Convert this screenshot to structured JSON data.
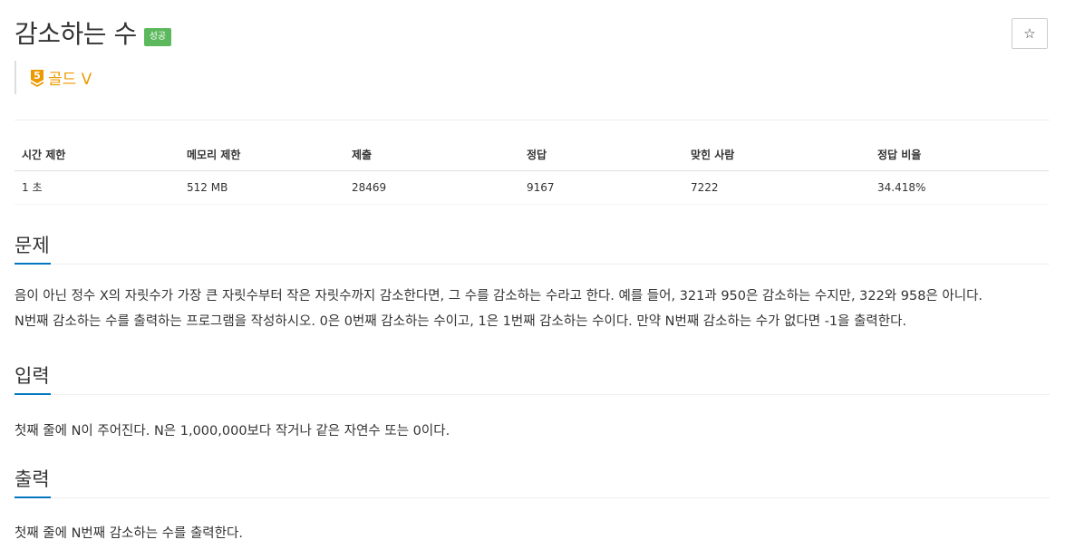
{
  "problem": {
    "title": "감소하는 수",
    "result_badge": "성공",
    "star_icon": "☆",
    "tier": {
      "number": "5",
      "label": "골드 V",
      "color": "#ec9a00"
    }
  },
  "stats": {
    "headers": [
      "시간 제한",
      "메모리 제한",
      "제출",
      "정답",
      "맞힌 사람",
      "정답 비율"
    ],
    "values": [
      "1 초",
      "512 MB",
      "28469",
      "9167",
      "7222",
      "34.418%"
    ]
  },
  "sections": {
    "description": {
      "title": "문제",
      "lines": [
        "음이 아닌 정수 X의 자릿수가 가장 큰 자릿수부터 작은 자릿수까지 감소한다면, 그 수를 감소하는 수라고 한다. 예를 들어, 321과 950은 감소하는 수지만, 322와 958은 아니다.",
        "N번째 감소하는 수를 출력하는 프로그램을 작성하시오. 0은 0번째 감소하는 수이고, 1은 1번째 감소하는 수이다. 만약 N번째 감소하는 수가 없다면 -1을 출력한다."
      ]
    },
    "input": {
      "title": "입력",
      "text": "첫째 줄에 N이 주어진다. N은 1,000,000보다 작거나 같은 자연수 또는 0이다."
    },
    "output": {
      "title": "출력",
      "text": "첫째 줄에 N번째 감소하는 수를 출력한다."
    }
  },
  "colors": {
    "success": "#5cb85c",
    "accent": "#0076c0",
    "gold": "#ec9a00"
  }
}
